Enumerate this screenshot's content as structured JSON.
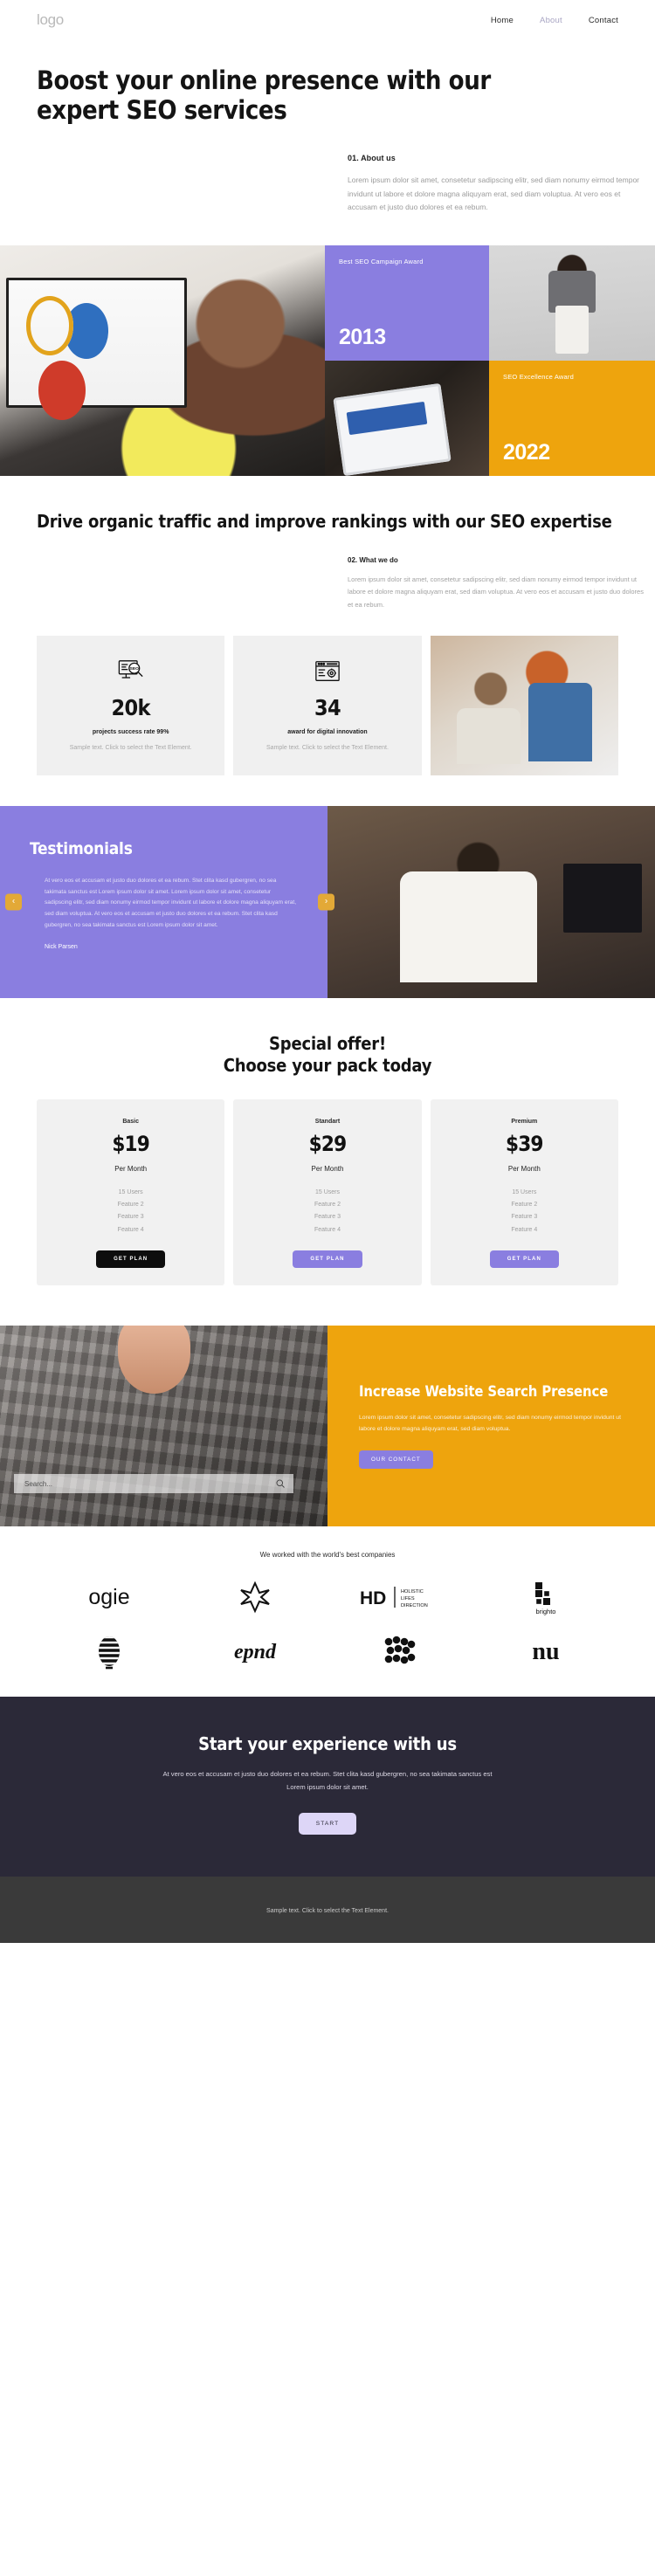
{
  "header": {
    "logo": "logo",
    "nav": [
      {
        "label": "Home",
        "muted": false
      },
      {
        "label": "About",
        "muted": true
      },
      {
        "label": "Contact",
        "muted": false
      }
    ]
  },
  "hero": {
    "title": "Boost your online presence with our expert SEO services",
    "about_eyebrow": "01. About us",
    "about_text": "Lorem ipsum dolor sit amet, consetetur sadipscing elitr, sed diam nonumy eirmod tempor invidunt ut labore et dolore magna aliquyam erat, sed diam voluptua. At vero eos et accusam et justo duo dolores et ea rebum."
  },
  "gallery": {
    "award_purple": {
      "title": "Best SEO Campaign Award",
      "year": "2013",
      "color": "#8a7ee0"
    },
    "award_orange": {
      "title": "SEO Excellence Award",
      "year": "2022",
      "color": "#eea40d"
    }
  },
  "section2": {
    "title": "Drive organic traffic and improve rankings with our SEO expertise",
    "eyebrow": "02. What we do",
    "text": "Lorem ipsum dolor sit amet, consetetur sadipscing elitr, sed diam nonumy eirmod tempor invidunt ut labore et dolore magna aliquyam erat, sed diam voluptua. At vero eos et accusam et justo duo dolores et ea rebum."
  },
  "stats": [
    {
      "icon": "seo-search-icon",
      "number": "20k",
      "label": "projects success rate 99%",
      "desc": "Sample text. Click to select the Text Element."
    },
    {
      "icon": "browser-gear-icon",
      "number": "34",
      "label": "award for digital innovation",
      "desc": "Sample text. Click to select the Text Element."
    }
  ],
  "testimonials": {
    "title": "Testimonials",
    "quote": "At vero eos et accusam et justo duo dolores et ea rebum. Stet clita kasd gubergren, no sea takimata sanctus est Lorem ipsum dolor sit amet. Lorem ipsum dolor sit amet, consetetur sadipscing elitr, sed diam nonumy eirmod tempor invidunt ut labore et dolore magna aliquyam erat, sed diam voluptua. At vero eos et accusam et justo duo dolores et ea rebum. Stet clita kasd gubergren, no sea takimata sanctus est Lorem ipsum dolor sit amet.",
    "author": "Nick Parsen",
    "prev": "‹",
    "next": "›",
    "accent": "#8a7ee0",
    "arrow_color": "#e3a937"
  },
  "pricing": {
    "title_line1": "Special offer!",
    "title_line2": "Choose your pack today",
    "plans": [
      {
        "name": "Basic",
        "price": "$19",
        "period": "Per Month",
        "features": [
          "15 Users",
          "Feature 2",
          "Feature 3",
          "Feature 4"
        ],
        "button": "GET PLAN",
        "button_style": "dark"
      },
      {
        "name": "Standart",
        "price": "$29",
        "period": "Per Month",
        "features": [
          "15 Users",
          "Feature 2",
          "Feature 3",
          "Feature 4"
        ],
        "button": "GET PLAN",
        "button_style": "purple"
      },
      {
        "name": "Premium",
        "price": "$39",
        "period": "Per Month",
        "features": [
          "15 Users",
          "Feature 2",
          "Feature 3",
          "Feature 4"
        ],
        "button": "GET PLAN",
        "button_style": "purple"
      }
    ]
  },
  "promo": {
    "search_placeholder": "Search...",
    "title": "Increase Website Search Presence",
    "text": "Lorem ipsum dolor sit amet, consetetur sadipscing elitr, sed diam nonumy eirmod tempor invidunt ut labore et dolore magna aliquyam erat, sed diam voluptua.",
    "button": "OUR CONTACT",
    "bg": "#eea40d"
  },
  "clients": {
    "heading": "We worked with the world's best companies",
    "logos": [
      {
        "name": "ogie-logo",
        "text": "ogie"
      },
      {
        "name": "flower-star-logo",
        "text": ""
      },
      {
        "name": "hd-holistic-lifes-direction-logo",
        "text": "HD"
      },
      {
        "name": "brighto-logo",
        "text": "brighto"
      },
      {
        "name": "striped-oval-logo",
        "text": ""
      },
      {
        "name": "epnd-script-logo",
        "text": "epnd"
      },
      {
        "name": "dots-cluster-logo",
        "text": ""
      },
      {
        "name": "nu-serif-logo",
        "text": "nu"
      }
    ],
    "hd_lines": [
      "HOLISTIC",
      "LIFES",
      "DIRECTION"
    ]
  },
  "cta": {
    "title": "Start your experience with us",
    "text": "At vero eos et accusam et justo duo dolores et ea rebum. Stet clita kasd gubergren, no sea takimata sanctus est Lorem ipsum dolor sit amet.",
    "button": "START",
    "bg": "#2b2938"
  },
  "footer": {
    "text": "Sample text. Click to select the Text Element."
  }
}
